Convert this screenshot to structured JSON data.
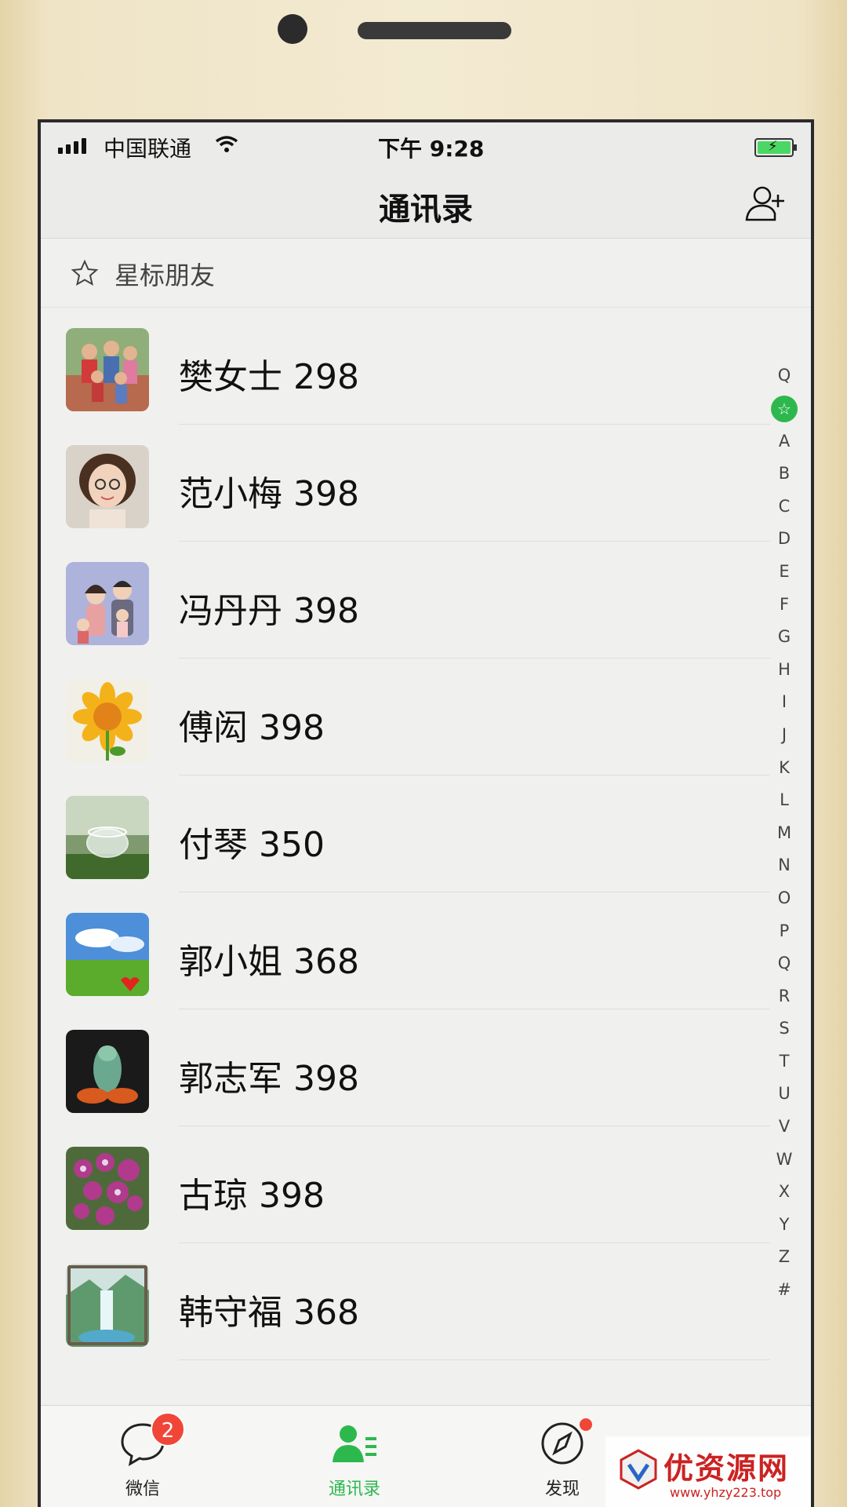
{
  "status_bar": {
    "carrier": "中国联通",
    "time": "下午 9:28"
  },
  "nav": {
    "title": "通讯录"
  },
  "starred": {
    "label": "星标朋友"
  },
  "contacts": [
    {
      "name": "樊女士 298",
      "avatar": "family-photo"
    },
    {
      "name": "范小梅 398",
      "avatar": "cartoon-woman"
    },
    {
      "name": "冯丹丹 398",
      "avatar": "cartoon-family"
    },
    {
      "name": "傅闳 398",
      "avatar": "sunflower"
    },
    {
      "name": "付琴 350",
      "avatar": "glass-cup"
    },
    {
      "name": "郭小姐 368",
      "avatar": "sky-meadow"
    },
    {
      "name": "郭志军 398",
      "avatar": "jade-carving"
    },
    {
      "name": "古琼 398",
      "avatar": "purple-flowers"
    },
    {
      "name": "韩守福 368",
      "avatar": "waterfall-painting"
    }
  ],
  "index_bar": [
    "A",
    "B",
    "C",
    "D",
    "E",
    "F",
    "G",
    "H",
    "I",
    "J",
    "K",
    "L",
    "M",
    "N",
    "O",
    "P",
    "Q",
    "R",
    "S",
    "T",
    "U",
    "V",
    "W",
    "X",
    "Y",
    "Z",
    "#"
  ],
  "index_top": "Q",
  "tabs": [
    {
      "label": "微信",
      "badge": "2",
      "icon": "chat-bubble-icon"
    },
    {
      "label": "通讯录",
      "icon": "contacts-icon",
      "active": true
    },
    {
      "label": "发现",
      "icon": "compass-icon"
    }
  ],
  "watermark": {
    "text": "优资源网",
    "url": "www.yhzy223.top"
  },
  "colors": {
    "accent": "#2db84e",
    "badge": "#f04637"
  }
}
